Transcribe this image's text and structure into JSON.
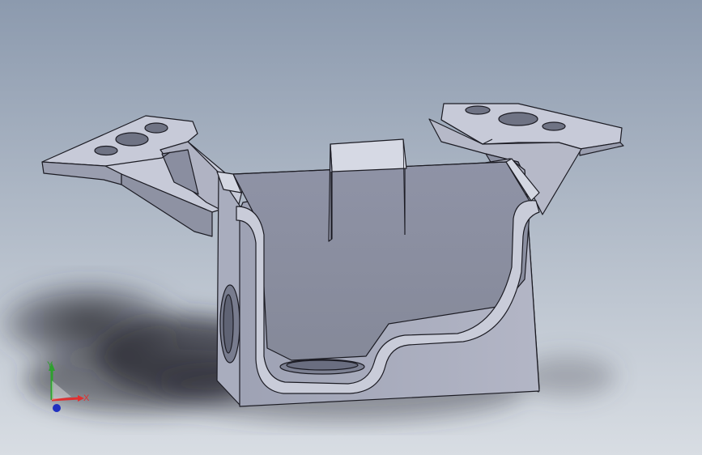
{
  "viewport": {
    "background_top": "#8c9aae",
    "background_bottom": "#d8dde3"
  },
  "model": {
    "face_light": "#c5c8d6",
    "face_mid": "#a9adbe",
    "face_dark": "#888c9c",
    "edge": "#1c1c24"
  },
  "triad": {
    "x_label": "X",
    "y_label": "Y",
    "x_color": "#e03030",
    "y_color": "#2ea02e",
    "z_color": "#2030c0"
  }
}
